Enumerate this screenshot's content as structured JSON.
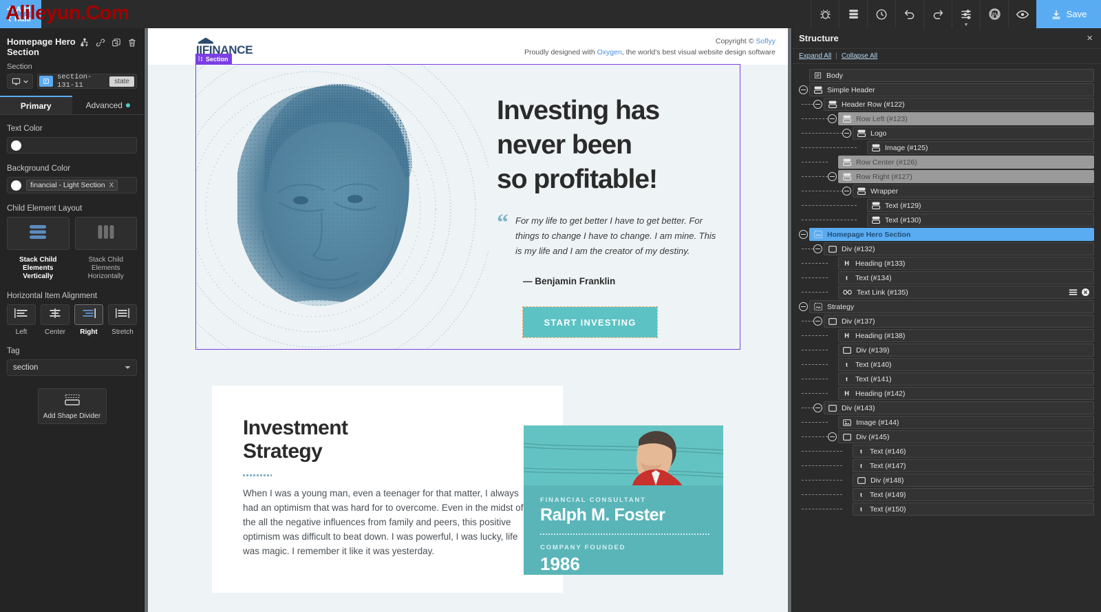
{
  "watermark": {
    "text": "Alileyun.Com"
  },
  "topbar": {
    "add_label": "Add",
    "hide_label": "Hide",
    "save_label": "Save",
    "tools": [
      {
        "name": "bug-icon",
        "title": "Debug"
      },
      {
        "name": "structure-icon",
        "title": "Structure"
      },
      {
        "name": "clock-icon",
        "title": "History"
      },
      {
        "name": "undo-icon",
        "title": "Undo"
      },
      {
        "name": "redo-icon",
        "title": "Redo"
      },
      {
        "name": "sliders-icon",
        "title": "Settings"
      },
      {
        "name": "wordpress-icon",
        "title": "WordPress"
      },
      {
        "name": "eye-icon",
        "title": "Preview"
      }
    ],
    "accent_color": "#5aacf2"
  },
  "left_panel": {
    "title": "Homepage Hero Section",
    "element_type": "Section",
    "id_value": "section-131-11",
    "state_label": "state",
    "header_icons": [
      "sitemap-icon",
      "link-icon",
      "duplicate-icon",
      "trash-icon"
    ],
    "tabs": [
      {
        "label": "Primary",
        "active": true,
        "dot": false
      },
      {
        "label": "Advanced",
        "active": false,
        "dot": true
      }
    ],
    "text_color": {
      "label": "Text Color",
      "value": "",
      "swatch": "#ffffff"
    },
    "background_color": {
      "label": "Background Color",
      "token": "financial - Light Section",
      "remove_label": "X",
      "swatch": "#ffffff"
    },
    "child_layout": {
      "label": "Child Element Layout",
      "options": [
        {
          "caption": "Stack Child Elements Vertically",
          "selected": true,
          "icon": "stack-vertical-icon"
        },
        {
          "caption": "Stack Child Elements Horizontally",
          "selected": false,
          "icon": "stack-horizontal-icon"
        }
      ]
    },
    "horizontal_alignment": {
      "label": "Horizontal Item Alignment",
      "options": [
        {
          "caption": "Left",
          "selected": false
        },
        {
          "caption": "Center",
          "selected": false
        },
        {
          "caption": "Right",
          "selected": true
        },
        {
          "caption": "Stretch",
          "selected": false
        }
      ]
    },
    "tag": {
      "label": "Tag",
      "value": "section"
    },
    "shape_divider": {
      "label": "Add Shape Divider"
    }
  },
  "canvas": {
    "site_header": {
      "logo_text": "IIFINANCE",
      "copyright_prefix": "Copyright © ",
      "copyright_link": "Soflyy",
      "tagline_prefix": "Proudly designed with ",
      "tagline_link": "Oxygen",
      "tagline_suffix": ", the world's best visual website design software"
    },
    "section_badge": "Section",
    "hero": {
      "heading_lines": [
        "Investing has",
        "never been",
        "so profitable!"
      ],
      "quote": "For my life to get better I have to get better. For things to change I have to change. I am mine. This is my life and I am the creator of my destiny.",
      "attribution": "— Benjamin Franklin",
      "cta_label": "START INVESTING",
      "cta_color": "#5cc2c4"
    },
    "strategy": {
      "heading_lines": [
        "Investment",
        "Strategy"
      ],
      "paragraph": "When I was a young man, even a teenager for that matter, I always had an optimism that was hard for to overcome. Even in the midst of the all the negative influences from family and peers, this positive optimism was difficult to beat down. I was powerful, I was lucky, life was magic. I remember it like it was yesterday."
    },
    "person_card": {
      "role_kicker": "FINANCIAL CONSULTANT",
      "name": "Ralph M. Foster",
      "founded_kicker": "COMPANY FOUNDED",
      "founded_year": "1986",
      "card_color": "#5ab5b8"
    }
  },
  "structure": {
    "title": "Structure",
    "expand_all": "Expand All",
    "collapse_all": "Collapse All",
    "separator": "|",
    "close_label": "×",
    "tree": [
      {
        "label": "Body",
        "depth": 0,
        "icon": "body-icon",
        "toggle": false,
        "style": "normal"
      },
      {
        "label": "Simple Header",
        "depth": 0,
        "icon": "section-icon",
        "toggle": true,
        "style": "normal"
      },
      {
        "label": "Header Row (#122)",
        "depth": 1,
        "icon": "section-icon",
        "toggle": true,
        "style": "normal"
      },
      {
        "label": "Row Left (#123)",
        "depth": 2,
        "icon": "section-icon",
        "toggle": true,
        "style": "dim"
      },
      {
        "label": "Logo",
        "depth": 3,
        "icon": "section-icon",
        "toggle": true,
        "style": "normal"
      },
      {
        "label": "Image (#125)",
        "depth": 4,
        "icon": "section-icon",
        "toggle": false,
        "style": "normal"
      },
      {
        "label": "Row Center (#126)",
        "depth": 2,
        "icon": "section-icon",
        "toggle": false,
        "style": "dim"
      },
      {
        "label": "Row Right (#127)",
        "depth": 2,
        "icon": "section-icon",
        "toggle": true,
        "style": "dim"
      },
      {
        "label": "Wrapper",
        "depth": 3,
        "icon": "section-icon",
        "toggle": true,
        "style": "normal"
      },
      {
        "label": "Text (#129)",
        "depth": 4,
        "icon": "section-icon",
        "toggle": false,
        "style": "normal"
      },
      {
        "label": "Text (#130)",
        "depth": 4,
        "icon": "section-icon",
        "toggle": false,
        "style": "normal"
      },
      {
        "label": "Homepage Hero Section",
        "depth": 0,
        "icon": "hero-icon",
        "toggle": true,
        "style": "selected"
      },
      {
        "label": "Div (#132)",
        "depth": 1,
        "icon": "div-icon",
        "toggle": true,
        "style": "normal"
      },
      {
        "label": "Heading (#133)",
        "depth": 2,
        "icon": "heading-icon",
        "toggle": false,
        "style": "normal"
      },
      {
        "label": "Text (#134)",
        "depth": 2,
        "icon": "text-icon",
        "toggle": false,
        "style": "normal"
      },
      {
        "label": "Text Link (#135)",
        "depth": 2,
        "icon": "link-icon",
        "toggle": false,
        "style": "normal",
        "actions": [
          "menu-icon",
          "close-icon"
        ]
      },
      {
        "label": "Strategy",
        "depth": 0,
        "icon": "hero-icon",
        "toggle": true,
        "style": "normal"
      },
      {
        "label": "Div (#137)",
        "depth": 1,
        "icon": "div-icon",
        "toggle": true,
        "style": "normal"
      },
      {
        "label": "Heading (#138)",
        "depth": 2,
        "icon": "heading-icon",
        "toggle": false,
        "style": "normal"
      },
      {
        "label": "Div (#139)",
        "depth": 2,
        "icon": "div-icon",
        "toggle": false,
        "style": "normal"
      },
      {
        "label": "Text (#140)",
        "depth": 2,
        "icon": "text-icon",
        "toggle": false,
        "style": "normal"
      },
      {
        "label": "Text (#141)",
        "depth": 2,
        "icon": "text-icon",
        "toggle": false,
        "style": "normal"
      },
      {
        "label": "Heading (#142)",
        "depth": 2,
        "icon": "heading-icon",
        "toggle": false,
        "style": "normal"
      },
      {
        "label": "Div (#143)",
        "depth": 1,
        "icon": "div-icon",
        "toggle": true,
        "style": "normal"
      },
      {
        "label": "Image (#144)",
        "depth": 2,
        "icon": "image-icon",
        "toggle": false,
        "style": "normal"
      },
      {
        "label": "Div (#145)",
        "depth": 2,
        "icon": "div-icon",
        "toggle": true,
        "style": "normal"
      },
      {
        "label": "Text (#146)",
        "depth": 3,
        "icon": "text-icon",
        "toggle": false,
        "style": "normal"
      },
      {
        "label": "Text (#147)",
        "depth": 3,
        "icon": "text-icon",
        "toggle": false,
        "style": "normal"
      },
      {
        "label": "Div (#148)",
        "depth": 3,
        "icon": "div-icon",
        "toggle": false,
        "style": "normal"
      },
      {
        "label": "Text (#149)",
        "depth": 3,
        "icon": "text-icon",
        "toggle": false,
        "style": "normal"
      },
      {
        "label": "Text (#150)",
        "depth": 3,
        "icon": "text-icon",
        "toggle": false,
        "style": "normal"
      }
    ]
  }
}
